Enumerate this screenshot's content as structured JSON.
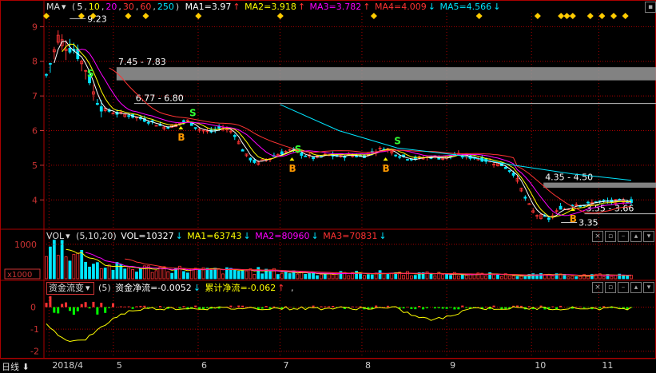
{
  "main_header": {
    "ma_label": "MA",
    "params_open": "(",
    "params": [
      {
        "t": "5",
        "c": "#ffffff"
      },
      {
        "t": ",",
        "c": "#cccccc"
      },
      {
        "t": "10",
        "c": "#ffff00"
      },
      {
        "t": ",",
        "c": "#cccccc"
      },
      {
        "t": "20",
        "c": "#ff00ff"
      },
      {
        "t": ",",
        "c": "#cccccc"
      },
      {
        "t": "30",
        "c": "#ff3333"
      },
      {
        "t": ",",
        "c": "#cccccc"
      },
      {
        "t": "60",
        "c": "#ff3333"
      },
      {
        "t": ",",
        "c": "#cccccc"
      },
      {
        "t": "250",
        "c": "#00e5ff"
      }
    ],
    "params_close": ")",
    "items": [
      {
        "text": "MA1=3.97",
        "arrow": "↑",
        "color": "#ffffff",
        "arrow_color": "#ff3333"
      },
      {
        "text": "MA2=3.918",
        "arrow": "↑",
        "color": "#ffff00",
        "arrow_color": "#ff3333"
      },
      {
        "text": "MA3=3.782",
        "arrow": "↑",
        "color": "#ff00ff",
        "arrow_color": "#ff3333"
      },
      {
        "text": "MA4=4.009",
        "arrow": "↓",
        "color": "#ff3333",
        "arrow_color": "#00e5ff"
      },
      {
        "text": "MA5=4.566",
        "arrow": "↓",
        "color": "#00e5ff",
        "arrow_color": "#00e5ff"
      }
    ]
  },
  "vol_header": {
    "label": "VOL",
    "params": "(5,10,20)",
    "items": [
      {
        "text": "VOL=10327",
        "arrow": "↓",
        "color": "#ffffff",
        "arrow_color": "#00e5ff"
      },
      {
        "text": "MA1=63743",
        "arrow": "↓",
        "color": "#ffff00",
        "arrow_color": "#00e5ff"
      },
      {
        "text": "MA2=80960",
        "arrow": "↓",
        "color": "#ff00ff",
        "arrow_color": "#00e5ff"
      },
      {
        "text": "MA3=70831",
        "arrow": "↓",
        "color": "#ff3333",
        "arrow_color": "#00e5ff"
      }
    ]
  },
  "flow_header": {
    "indicator": "资金流变",
    "param": "(5)",
    "items": [
      {
        "text": "资金净流=-0.0052",
        "arrow": "↓",
        "color": "#ffffff",
        "arrow_color": "#00e5ff"
      },
      {
        "text": "累计净流=-0.062",
        "arrow": "↑",
        "color": "#ffff00",
        "arrow_color": "#ff3333"
      }
    ],
    "suffix": ","
  },
  "bottom_bar": {
    "period_button": "日线",
    "period_arrow": "⬇",
    "x_labels": [
      {
        "text": "2018/4",
        "t": 0.01
      },
      {
        "text": "5",
        "t": 0.12
      },
      {
        "text": "6",
        "t": 0.265
      },
      {
        "text": "7",
        "t": 0.405
      },
      {
        "text": "8",
        "t": 0.545
      },
      {
        "text": "9",
        "t": 0.69
      },
      {
        "text": "10",
        "t": 0.835
      },
      {
        "text": "11",
        "t": 0.95
      }
    ]
  },
  "chart_data": [
    {
      "type": "candlestick",
      "title": "",
      "ylim": [
        3.2,
        9.4
      ],
      "y_ticks": [
        4,
        5,
        6,
        7,
        8,
        9
      ],
      "x_range": [
        0,
        1
      ],
      "price_path": [
        [
          0.0,
          7.6
        ],
        [
          0.01,
          8.1
        ],
        [
          0.02,
          8.7
        ],
        [
          0.03,
          8.5
        ],
        [
          0.04,
          8.4
        ],
        [
          0.05,
          8.3
        ],
        [
          0.06,
          8.0
        ],
        [
          0.07,
          7.7
        ],
        [
          0.08,
          7.1
        ],
        [
          0.09,
          6.8
        ],
        [
          0.1,
          6.6
        ],
        [
          0.12,
          6.5
        ],
        [
          0.14,
          6.45
        ],
        [
          0.16,
          6.35
        ],
        [
          0.18,
          6.25
        ],
        [
          0.2,
          6.1
        ],
        [
          0.22,
          6.15
        ],
        [
          0.24,
          6.3
        ],
        [
          0.26,
          6.05
        ],
        [
          0.28,
          5.95
        ],
        [
          0.3,
          6.1
        ],
        [
          0.32,
          5.95
        ],
        [
          0.34,
          5.3
        ],
        [
          0.36,
          5.05
        ],
        [
          0.38,
          5.2
        ],
        [
          0.4,
          5.35
        ],
        [
          0.42,
          5.45
        ],
        [
          0.44,
          5.3
        ],
        [
          0.46,
          5.2
        ],
        [
          0.48,
          5.3
        ],
        [
          0.5,
          5.25
        ],
        [
          0.52,
          5.3
        ],
        [
          0.54,
          5.25
        ],
        [
          0.56,
          5.4
        ],
        [
          0.58,
          5.5
        ],
        [
          0.6,
          5.3
        ],
        [
          0.62,
          5.2
        ],
        [
          0.64,
          5.2
        ],
        [
          0.66,
          5.25
        ],
        [
          0.68,
          5.2
        ],
        [
          0.7,
          5.3
        ],
        [
          0.72,
          5.25
        ],
        [
          0.74,
          5.2
        ],
        [
          0.76,
          5.1
        ],
        [
          0.78,
          5.0
        ],
        [
          0.8,
          4.75
        ],
        [
          0.81,
          4.4
        ],
        [
          0.82,
          4.0
        ],
        [
          0.83,
          3.7
        ],
        [
          0.84,
          3.55
        ],
        [
          0.86,
          3.45
        ],
        [
          0.87,
          3.6
        ],
        [
          0.88,
          3.8
        ],
        [
          0.89,
          3.7
        ],
        [
          0.9,
          3.9
        ],
        [
          0.92,
          3.85
        ],
        [
          0.94,
          3.95
        ],
        [
          0.96,
          3.95
        ],
        [
          1.0,
          3.97
        ]
      ],
      "ma_series": [
        {
          "name": "MA1",
          "color": "#ffffff",
          "smooth": 2,
          "lag": 0.0
        },
        {
          "name": "MA2",
          "color": "#ffff00",
          "smooth": 4,
          "lag": 0.01
        },
        {
          "name": "MA3",
          "color": "#ff00ff",
          "smooth": 8,
          "lag": 0.02
        },
        {
          "name": "MA4",
          "color": "#ff3333",
          "smooth": 16,
          "lag": 0.035
        }
      ],
      "ma250": [
        [
          0.4,
          6.75
        ],
        [
          0.5,
          6.0
        ],
        [
          0.6,
          5.5
        ],
        [
          0.7,
          5.3
        ],
        [
          0.8,
          5.0
        ],
        [
          0.9,
          4.75
        ],
        [
          1.0,
          4.566
        ]
      ],
      "resistance_bands": [
        {
          "label": "7.45 - 7.83",
          "low": 7.45,
          "high": 7.83,
          "x_start": 0.12,
          "color": "#999999"
        },
        {
          "label": "4.35 - 4.50",
          "low": 4.35,
          "high": 4.5,
          "x_start": 0.85,
          "color": "#999999"
        }
      ],
      "h_lines": [
        {
          "label": "6.77 - 6.80",
          "y": 6.78,
          "x_start": 0.15
        },
        {
          "label": "3.55 - 3.66",
          "y": 3.6,
          "x_start": 0.92
        }
      ],
      "red_lines": [
        9.0,
        8.0,
        7.0,
        6.0,
        5.0,
        4.0
      ],
      "point_labels": [
        {
          "text": "9.23",
          "x": 0.04,
          "y": 9.23
        },
        {
          "text": "3.35",
          "x": 0.88,
          "y": 3.35
        }
      ],
      "signals": [
        {
          "text": "S",
          "x": 0.075,
          "y": 7.7,
          "kind": "sell"
        },
        {
          "text": "S",
          "x": 0.25,
          "y": 6.55,
          "kind": "sell"
        },
        {
          "text": "B",
          "x": 0.23,
          "y": 5.85,
          "kind": "buy"
        },
        {
          "text": "S",
          "x": 0.43,
          "y": 5.5,
          "kind": "sell"
        },
        {
          "text": "B",
          "x": 0.42,
          "y": 4.95,
          "kind": "buy"
        },
        {
          "text": "S",
          "x": 0.6,
          "y": 5.75,
          "kind": "sell"
        },
        {
          "text": "B",
          "x": 0.58,
          "y": 4.95,
          "kind": "buy"
        },
        {
          "text": "B",
          "x": 0.9,
          "y": 3.5,
          "kind": "buy"
        }
      ],
      "diamonds_x": [
        0.0,
        0.06,
        0.08,
        0.14,
        0.17,
        0.26,
        0.4,
        0.56,
        0.74,
        0.84,
        0.88,
        0.89,
        0.9,
        0.93,
        0.95,
        0.97,
        0.99
      ]
    },
    {
      "type": "bar",
      "title": "VOL",
      "y_ticks": [
        "1000"
      ],
      "unit_label": "x1000",
      "profile": [
        [
          0.0,
          700
        ],
        [
          0.02,
          1100
        ],
        [
          0.04,
          850
        ],
        [
          0.06,
          700
        ],
        [
          0.08,
          500
        ],
        [
          0.1,
          380
        ],
        [
          0.15,
          300
        ],
        [
          0.2,
          320
        ],
        [
          0.25,
          260
        ],
        [
          0.3,
          240
        ],
        [
          0.35,
          250
        ],
        [
          0.4,
          210
        ],
        [
          0.45,
          180
        ],
        [
          0.5,
          160
        ],
        [
          0.55,
          170
        ],
        [
          0.6,
          180
        ],
        [
          0.65,
          150
        ],
        [
          0.7,
          140
        ],
        [
          0.75,
          130
        ],
        [
          0.8,
          120
        ],
        [
          0.85,
          110
        ],
        [
          0.9,
          100
        ],
        [
          0.95,
          110
        ],
        [
          1.0,
          100
        ]
      ],
      "ylim": [
        0,
        1300
      ]
    },
    {
      "type": "bar",
      "title": "资金流变",
      "ylim": [
        -2.3,
        0.6
      ],
      "y_ticks": [
        0,
        -1,
        -2
      ],
      "series": [
        {
          "name": "资金净流",
          "color": "#00ff00"
        },
        {
          "name": "累计净流",
          "color": "#ffff00"
        }
      ]
    }
  ]
}
